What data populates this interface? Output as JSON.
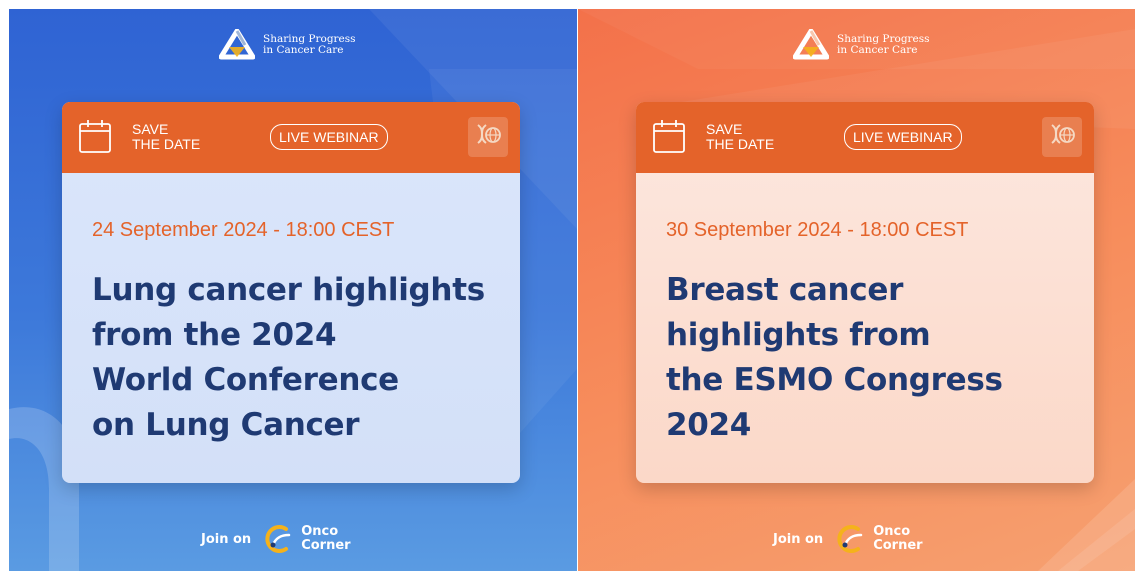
{
  "brand": {
    "line1": "Sharing Progress",
    "line2": "in Cancer Care"
  },
  "panels": [
    {
      "save_line1": "SAVE",
      "save_line2": "THE DATE",
      "live_label": "LIVE WEBINAR",
      "date": "24 September 2024 - 18:00 CEST",
      "headline": [
        "Lung cancer highlights",
        "from the 2024",
        "World Conference",
        "on Lung Cancer"
      ],
      "join_label": "Join on",
      "onco_line1": "Onco",
      "onco_line2": "Corner"
    },
    {
      "save_line1": "SAVE",
      "save_line2": "THE DATE",
      "live_label": "LIVE WEBINAR",
      "date": "30 September 2024 - 18:00 CEST",
      "headline": [
        "Breast cancer",
        "highlights from",
        "the ESMO Congress",
        "2024"
      ],
      "join_label": "Join on",
      "onco_line1": "Onco",
      "onco_line2": "Corner"
    }
  ],
  "colors": {
    "left_background": "#2f63d3",
    "right_background": "#f3714a",
    "header_orange": "#e4632a",
    "headline_navy": "#1f3a73",
    "logo_yellow": "#f5b21b"
  },
  "icons": {
    "brand_logo": "triangle-ribbon-icon",
    "calendar": "calendar-icon",
    "dna": "dna-globe-icon",
    "onco_logo": "onco-corner-logo-icon"
  }
}
